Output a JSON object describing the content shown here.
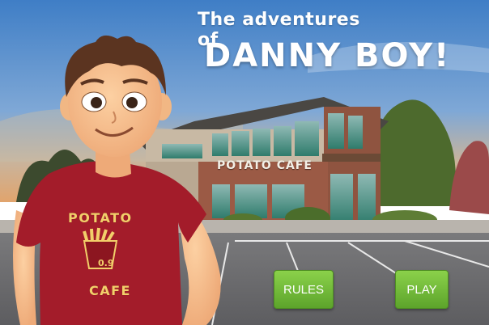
{
  "game": {
    "title_line1": "The adventures of",
    "title_line2": "DANNY BOY!"
  },
  "scene": {
    "building_sign": "POTATO CAFE"
  },
  "character": {
    "shirt_top": "POTATO",
    "shirt_bottom": "CAFE",
    "price": "0.9"
  },
  "buttons": {
    "rules": "RULES",
    "play": "PLAY"
  },
  "colors": {
    "button_green": "#6bb534",
    "shirt_red": "#a31c2a",
    "shirt_text": "#f2cf6a",
    "sky": "#4d87c5"
  }
}
